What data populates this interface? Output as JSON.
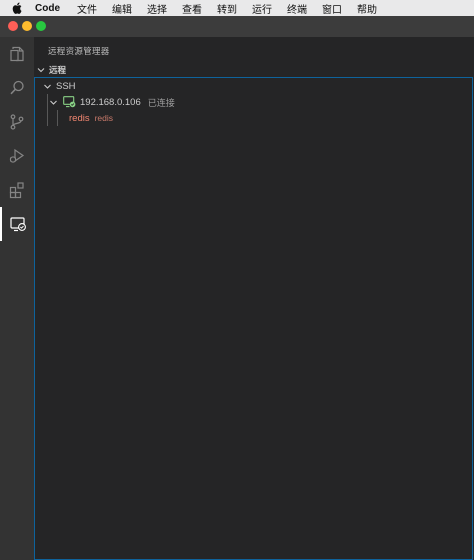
{
  "menubar": {
    "apple_icon": "apple-logo-icon",
    "items": [
      "Code",
      "文件",
      "编辑",
      "选择",
      "查看",
      "转到",
      "运行",
      "终端",
      "窗口",
      "帮助"
    ]
  },
  "activity_bar": {
    "items": [
      {
        "name": "explorer",
        "icon": "files-icon"
      },
      {
        "name": "search",
        "icon": "search-icon"
      },
      {
        "name": "source-control",
        "icon": "source-control-icon"
      },
      {
        "name": "run-debug",
        "icon": "run-debug-icon"
      },
      {
        "name": "extensions",
        "icon": "extensions-icon"
      },
      {
        "name": "remote-explorer",
        "icon": "remote-explorer-icon",
        "active": true
      }
    ]
  },
  "sidebar": {
    "title": "远程资源管理器",
    "section": "远程",
    "tree": {
      "group": "SSH",
      "host": {
        "label": "192.168.0.106",
        "status": "已连接",
        "icon": "remote-connected-icon"
      },
      "folder": {
        "label": "redis",
        "description": "redis"
      }
    }
  },
  "colors": {
    "menubar_bg": "#e9e9ea",
    "titlebar_bg": "#3c3c3c",
    "activitybar_bg": "#333333",
    "sidebar_bg": "#252526",
    "focus_border": "#0e639c",
    "connected_green": "#89d185",
    "redis_red": "#f48771",
    "close": "#ff5f57",
    "minimize": "#febc2e",
    "maximize": "#28c840"
  }
}
